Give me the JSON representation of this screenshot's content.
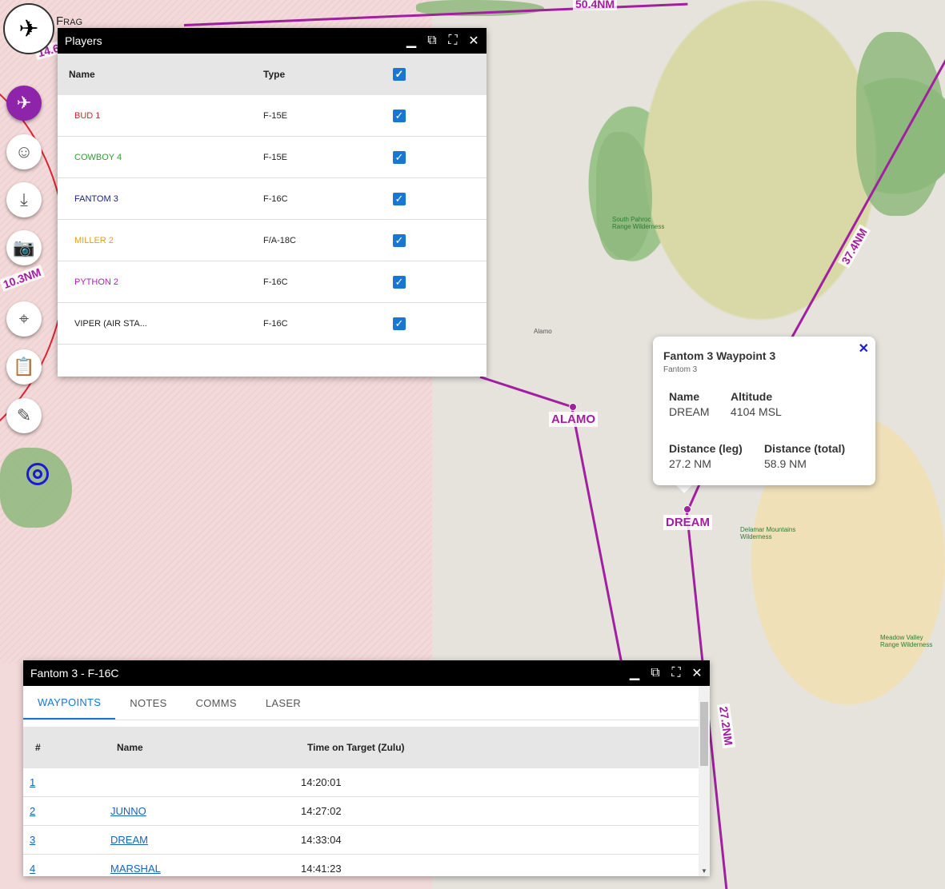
{
  "app": {
    "logo_text": "Frag"
  },
  "map": {
    "distances": [
      "50.4NM",
      "37.4NM",
      "27.2NM",
      "10.3NM",
      "14.6"
    ],
    "waypoints": [
      "ALAMO",
      "DREAM"
    ],
    "places": [
      "Alamo",
      "South Pahroc Range Wilderness",
      "Delamar Mountains Wilderness",
      "Meadow Valley Range Wilderness"
    ]
  },
  "sidebar": {
    "buttons": [
      {
        "name": "aircraft-icon",
        "glyph": "✈"
      },
      {
        "name": "pilot-icon",
        "glyph": "☺"
      },
      {
        "name": "landing-icon",
        "glyph": "⤓"
      },
      {
        "name": "camera-icon",
        "glyph": "📷"
      },
      {
        "name": "target-icon",
        "glyph": "⌖"
      },
      {
        "name": "clipboard-icon",
        "glyph": "📋"
      },
      {
        "name": "edit-icon",
        "glyph": "✎"
      }
    ]
  },
  "players_window": {
    "title": "Players",
    "headers": {
      "name": "Name",
      "type": "Type"
    },
    "rows": [
      {
        "name": "BUD 1",
        "type": "F-15E",
        "color": "#c62828"
      },
      {
        "name": "COWBOY 4",
        "type": "F-15E",
        "color": "#2e9e2e"
      },
      {
        "name": "FANTOM 3",
        "type": "F-16C",
        "color": "#1a237e"
      },
      {
        "name": "MILLER 2",
        "type": "F/A-18C",
        "color": "#e0a020"
      },
      {
        "name": "PYTHON 2",
        "type": "F-16C",
        "color": "#b020b0"
      },
      {
        "name": "VIPER (AIR STA...",
        "type": "F-16C",
        "color": "#222222"
      }
    ]
  },
  "popup": {
    "title": "Fantom 3 Waypoint 3",
    "subtitle": "Fantom 3",
    "name_label": "Name",
    "name_value": "DREAM",
    "alt_label": "Altitude",
    "alt_value": "4104 MSL",
    "leg_label": "Distance (leg)",
    "leg_value": "27.2 NM",
    "total_label": "Distance (total)",
    "total_value": "58.9 NM"
  },
  "flight_window": {
    "title": "Fantom 3 - F-16C",
    "tabs": [
      "WAYPOINTS",
      "NOTES",
      "COMMS",
      "LASER"
    ],
    "headers": {
      "num": "#",
      "name": "Name",
      "tot": "Time on Target (Zulu)"
    },
    "rows": [
      {
        "num": "1",
        "name": "",
        "tot": "14:20:01"
      },
      {
        "num": "2",
        "name": "JUNNO",
        "tot": "14:27:02"
      },
      {
        "num": "3",
        "name": "DREAM",
        "tot": "14:33:04"
      },
      {
        "num": "4",
        "name": "MARSHAL",
        "tot": "14:41:23"
      }
    ]
  },
  "colors": {
    "route": "#a020a0",
    "accent": "#1976d2",
    "active_button": "#8e24aa"
  }
}
